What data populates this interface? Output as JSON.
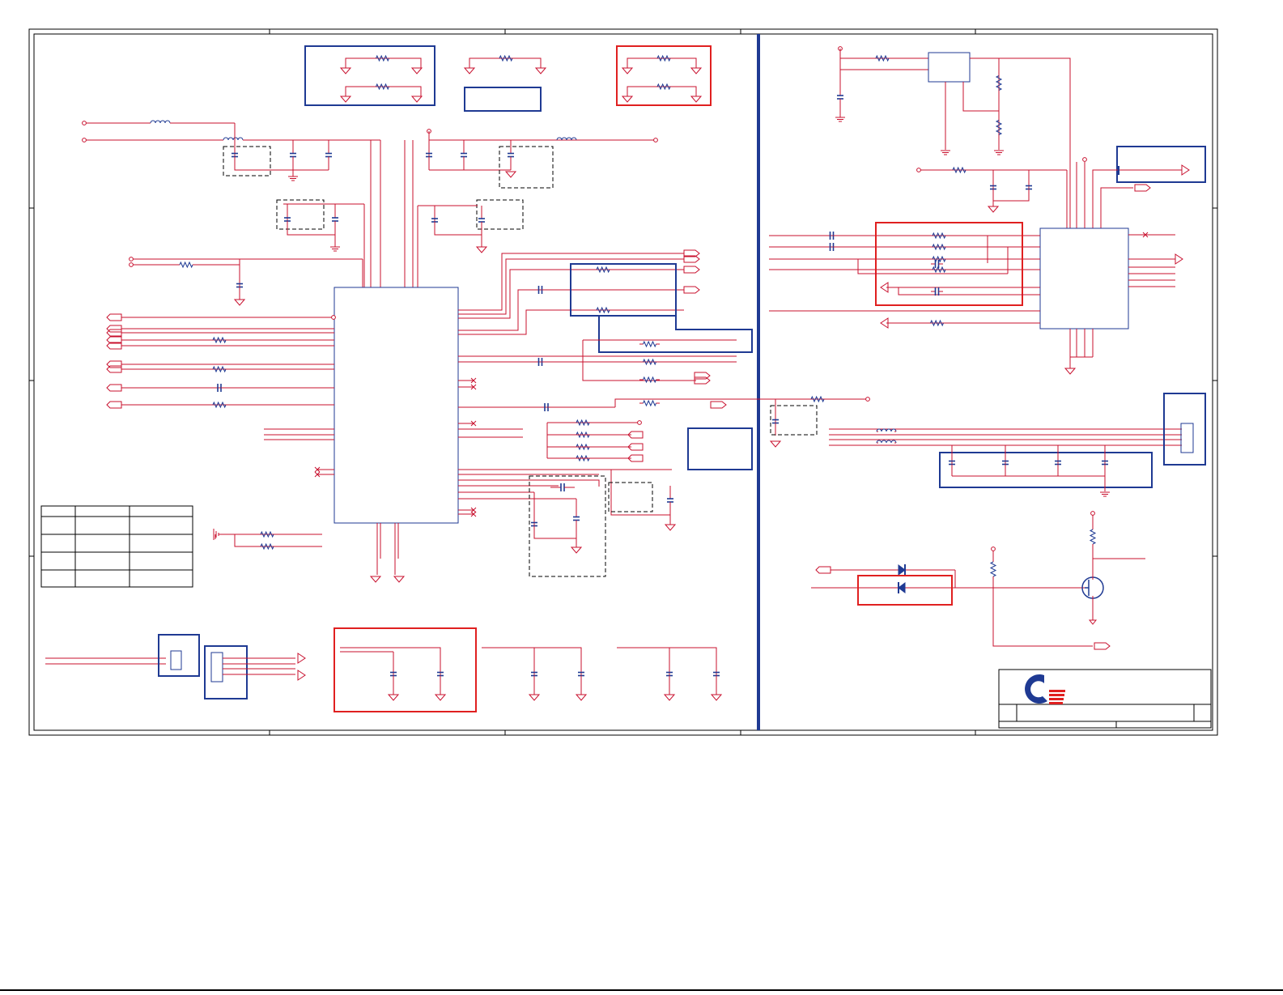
{
  "colors": {
    "wire": "#c8102e",
    "part": "#1f3a93",
    "block_blue": "#1f3a93",
    "block_red": "#e02020",
    "frame": "#000000",
    "dash": "#000000",
    "background": "#ffffff",
    "logo_blue": "#1f3a93",
    "logo_red": "#e02020"
  },
  "icons": {
    "logo": "company-logo-icon",
    "mosfet": "mosfet-icon",
    "diode": "diode-icon",
    "ground": "ground-icon",
    "resistor": "resistor-icon",
    "capacitor": "capacitor-icon",
    "inductor": "inductor-icon",
    "connector": "connector-icon"
  }
}
